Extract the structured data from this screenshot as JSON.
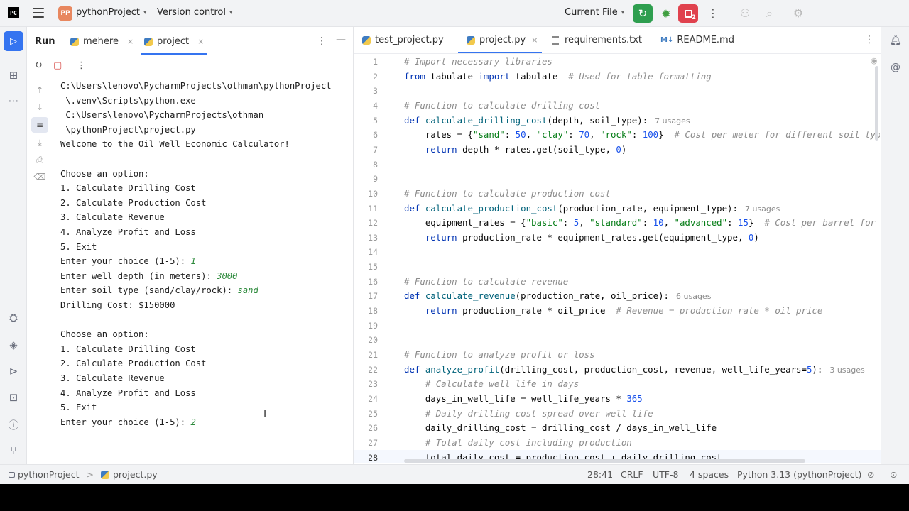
{
  "titlebar": {
    "logo": "PC",
    "project_badge": "PP",
    "project_name": "pythonProject",
    "vcs_label": "Version control",
    "current_file_label": "Current File",
    "stop_count": "2",
    "icons": [
      "pycharm-logo",
      "hamburger-menu-icon",
      "run-icon",
      "debug-icon",
      "stop-icon",
      "more-icon",
      "collab-icon",
      "search-icon",
      "settings-icon"
    ]
  },
  "left_strip": {
    "icons": [
      "project-icon",
      "structure-icon",
      "more-tools-icon",
      "python-packages-icon",
      "layers-icon",
      "services-icon",
      "terminal-icon",
      "problems-icon",
      "git-icon"
    ]
  },
  "run_panel": {
    "title": "Run",
    "tabs": [
      {
        "label": "mehere",
        "close": "×"
      },
      {
        "label": "project",
        "close": "×"
      }
    ],
    "console_lines": [
      {
        "t": "C:\\Users\\lenovo\\PycharmProjects\\othman\\pythonProject"
      },
      {
        "t": " \\.venv\\Scripts\\python.exe"
      },
      {
        "t": " C:\\Users\\lenovo\\PycharmProjects\\othman"
      },
      {
        "t": " \\pythonProject\\project.py"
      },
      {
        "t": "Welcome to the Oil Well Economic Calculator!"
      },
      {
        "t": ""
      },
      {
        "t": "Choose an option:"
      },
      {
        "t": "1. Calculate Drilling Cost"
      },
      {
        "t": "2. Calculate Production Cost"
      },
      {
        "t": "3. Calculate Revenue"
      },
      {
        "t": "4. Analyze Profit and Loss"
      },
      {
        "t": "5. Exit"
      },
      {
        "t": "Enter your choice (1-5): ",
        "input": "1"
      },
      {
        "t": "Enter well depth (in meters): ",
        "input": "3000"
      },
      {
        "t": "Enter soil type (sand/clay/rock): ",
        "input": "sand"
      },
      {
        "t": "Drilling Cost: $150000"
      },
      {
        "t": ""
      },
      {
        "t": "Choose an option:"
      },
      {
        "t": "1. Calculate Drilling Cost"
      },
      {
        "t": "2. Calculate Production Cost"
      },
      {
        "t": "3. Calculate Revenue"
      },
      {
        "t": "4. Analyze Profit and Loss"
      },
      {
        "t": "5. Exit"
      },
      {
        "t": "Enter your choice (1-5): ",
        "input": "2",
        "cursor": true
      }
    ]
  },
  "editor": {
    "tabs": [
      {
        "label": "test_project.py",
        "kind": "py"
      },
      {
        "label": "project.py",
        "kind": "py",
        "active": true,
        "close": "×"
      },
      {
        "label": "requirements.txt",
        "kind": "txt"
      },
      {
        "label": "README.md",
        "kind": "md",
        "prefix": "M↓"
      }
    ],
    "current_line": 28,
    "code": [
      [
        [
          "cm",
          "# Import necessary libraries"
        ]
      ],
      [
        [
          "kw",
          "from "
        ],
        [
          "",
          "tabulate "
        ],
        [
          "kw",
          "import "
        ],
        [
          "",
          "tabulate  "
        ],
        [
          "cm",
          "# Used for table formatting"
        ]
      ],
      [],
      [
        [
          "cm",
          "# Function to calculate drilling cost"
        ]
      ],
      [
        [
          "kw",
          "def "
        ],
        [
          "fn",
          "calculate_drilling_cost"
        ],
        [
          "",
          "(depth, soil_type):"
        ],
        [
          "us",
          "7 usages"
        ]
      ],
      [
        [
          "",
          "    rates = {"
        ],
        [
          "st",
          "\"sand\""
        ],
        [
          "",
          ": "
        ],
        [
          "nu",
          "50"
        ],
        [
          "",
          ", "
        ],
        [
          "st",
          "\"clay\""
        ],
        [
          "",
          ": "
        ],
        [
          "nu",
          "70"
        ],
        [
          "",
          ", "
        ],
        [
          "st",
          "\"rock\""
        ],
        [
          "",
          ": "
        ],
        [
          "nu",
          "100"
        ],
        [
          "",
          "}  "
        ],
        [
          "cm",
          "# Cost per meter for different soil typ"
        ]
      ],
      [
        [
          "kw",
          "    return "
        ],
        [
          "",
          "depth * rates.get(soil_type, "
        ],
        [
          "nu",
          "0"
        ],
        [
          "",
          ")"
        ]
      ],
      [],
      [],
      [
        [
          "cm",
          "# Function to calculate production cost"
        ]
      ],
      [
        [
          "kw",
          "def "
        ],
        [
          "fn",
          "calculate_production_cost"
        ],
        [
          "",
          "(production_rate, equipment_type):"
        ],
        [
          "us",
          "7 usages"
        ]
      ],
      [
        [
          "",
          "    equipment_rates = {"
        ],
        [
          "st",
          "\"basic\""
        ],
        [
          "",
          ": "
        ],
        [
          "nu",
          "5"
        ],
        [
          "",
          ", "
        ],
        [
          "st",
          "\"standard\""
        ],
        [
          "",
          ": "
        ],
        [
          "nu",
          "10"
        ],
        [
          "",
          ", "
        ],
        [
          "st",
          "\"advanced\""
        ],
        [
          "",
          ": "
        ],
        [
          "nu",
          "15"
        ],
        [
          "",
          "}  "
        ],
        [
          "cm",
          "# Cost per barrel for"
        ]
      ],
      [
        [
          "kw",
          "    return "
        ],
        [
          "",
          "production_rate * equipment_rates.get(equipment_type, "
        ],
        [
          "nu",
          "0"
        ],
        [
          "",
          ")"
        ]
      ],
      [],
      [],
      [
        [
          "cm",
          "# Function to calculate revenue"
        ]
      ],
      [
        [
          "kw",
          "def "
        ],
        [
          "fn",
          "calculate_revenue"
        ],
        [
          "",
          "(production_rate, oil_price):"
        ],
        [
          "us",
          "6 usages"
        ]
      ],
      [
        [
          "kw",
          "    return "
        ],
        [
          "",
          "production_rate * oil_price  "
        ],
        [
          "cm",
          "# Revenue = production rate * oil price"
        ]
      ],
      [],
      [],
      [
        [
          "cm",
          "# Function to analyze profit or loss"
        ]
      ],
      [
        [
          "kw",
          "def "
        ],
        [
          "fn",
          "analyze_profit"
        ],
        [
          "",
          "(drilling_cost, production_cost, revenue, well_life_years="
        ],
        [
          "nu",
          "5"
        ],
        [
          "",
          "):"
        ],
        [
          "us",
          "3 usages"
        ]
      ],
      [
        [
          "cm",
          "    # Calculate well life in days"
        ]
      ],
      [
        [
          "",
          "    days_in_well_life = well_life_years * "
        ],
        [
          "nu",
          "365"
        ]
      ],
      [
        [
          "cm",
          "    # Daily drilling cost spread over well life"
        ]
      ],
      [
        [
          "",
          "    daily_drilling_cost = drilling_cost / days_in_well_life"
        ]
      ],
      [
        [
          "cm",
          "    # Total daily cost including production"
        ]
      ],
      [
        [
          "",
          "    total_daily_cost = production_cost + daily_drilling_cost"
        ]
      ]
    ]
  },
  "statusbar": {
    "breadcrumb_project": "pythonProject",
    "breadcrumb_sep": ">",
    "breadcrumb_file": "project.py",
    "position": "28:41",
    "line_sep": "CRLF",
    "encoding": "UTF-8",
    "indent": "4 spaces",
    "interpreter": "Python 3.13 (pythonProject)"
  }
}
